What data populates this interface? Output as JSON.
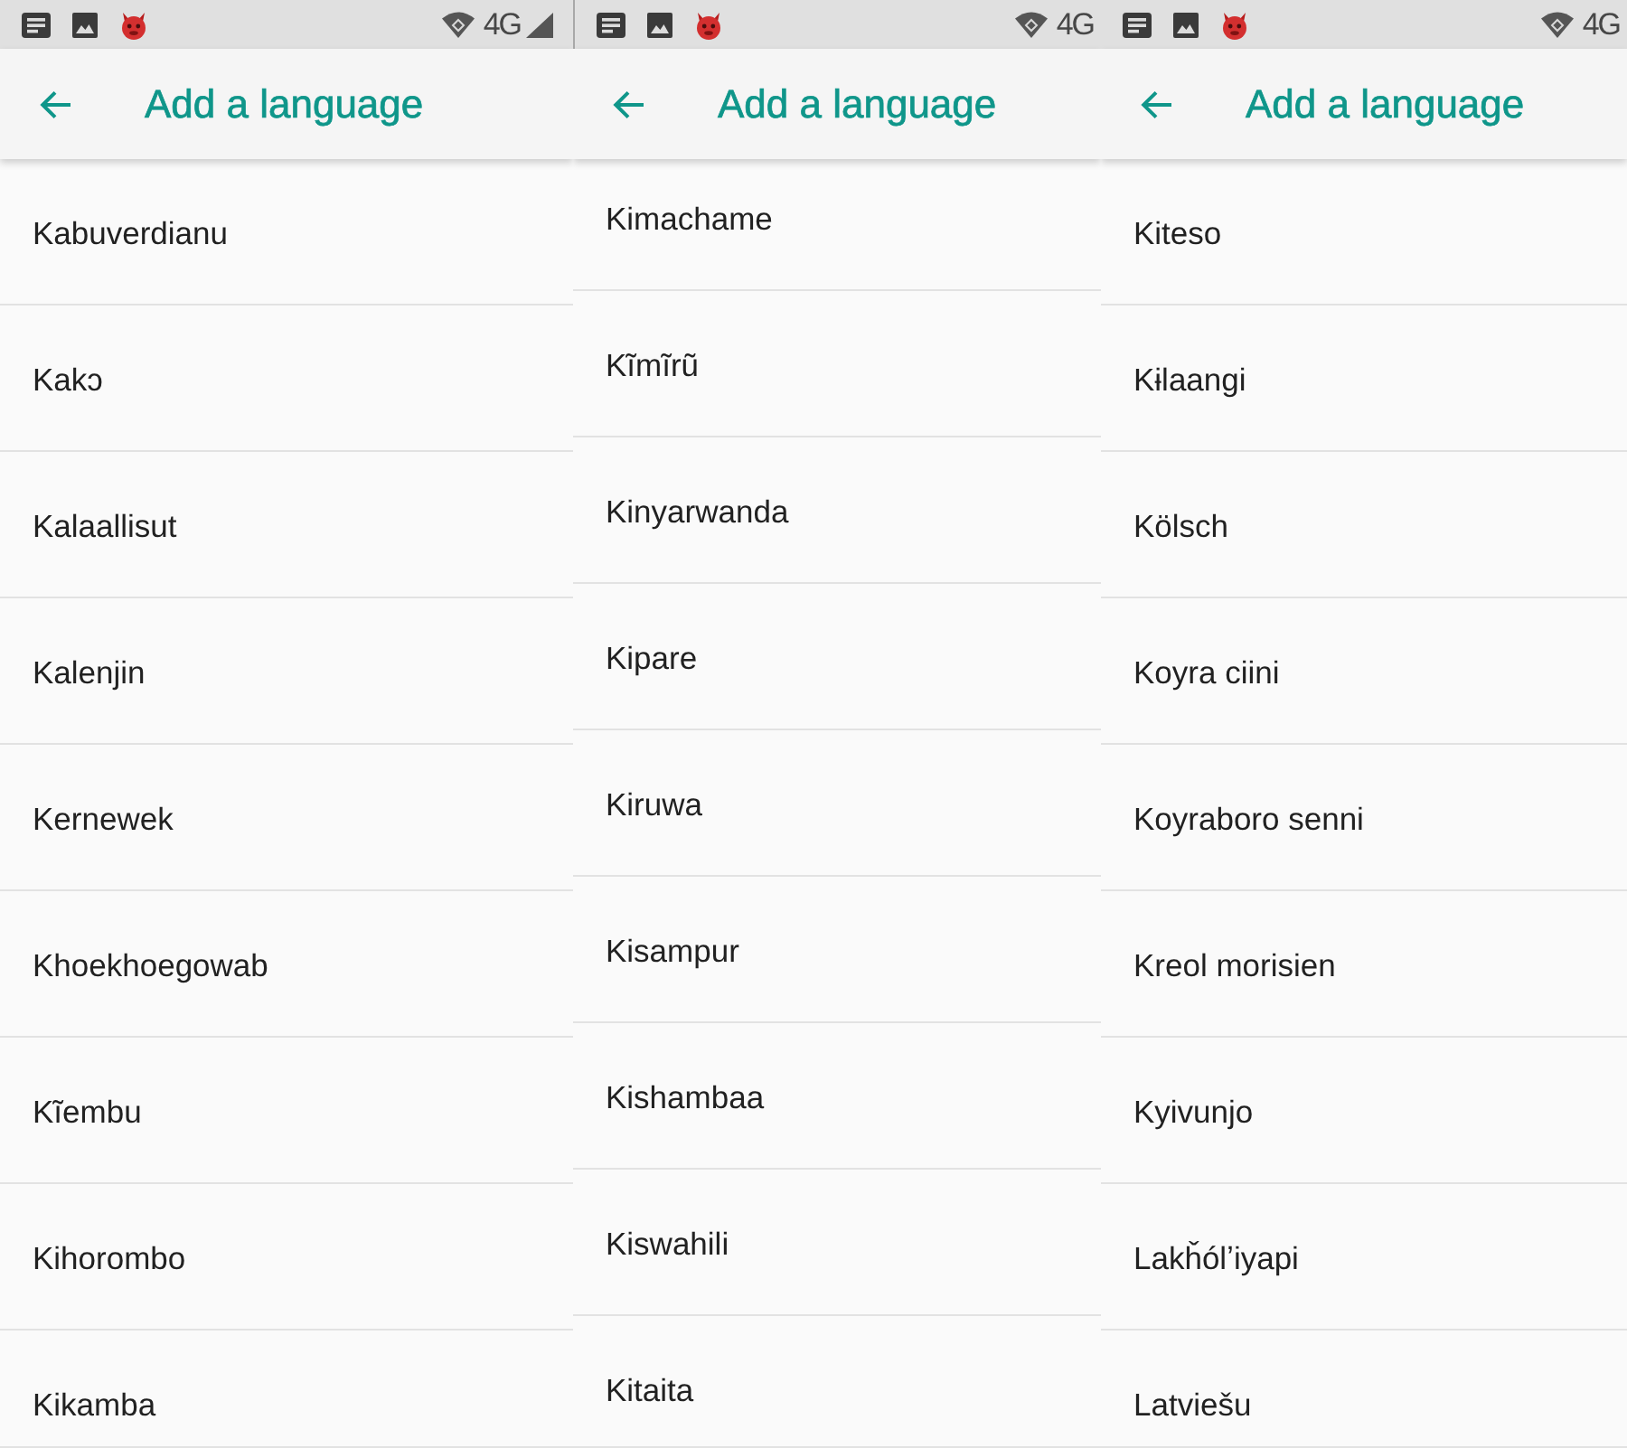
{
  "panels": [
    {
      "status_bar": {
        "network": "4G",
        "signal_icon": true
      },
      "toolbar": {
        "title": "Add a language"
      },
      "languages": [
        "Kabuverdianu",
        "Kakɔ",
        "Kalaallisut",
        "Kalenjin",
        "Kernewek",
        "Khoekhoegowab",
        "Kĩembu",
        "Kihorombo",
        "Kikamba"
      ]
    },
    {
      "status_bar": {
        "network": "4G",
        "signal_icon": false
      },
      "toolbar": {
        "title": "Add a language"
      },
      "languages": [
        "Kimachame",
        "Kĩmĩrũ",
        "Kinyarwanda",
        "Kipare",
        "Kiruwa",
        "Kisampur",
        "Kishambaa",
        "Kiswahili",
        "Kitaita"
      ]
    },
    {
      "status_bar": {
        "network": "4G",
        "signal_icon": false
      },
      "toolbar": {
        "title": "Add a language"
      },
      "languages": [
        "Kiteso",
        "Kɨlaangi",
        "Kölsch",
        "Koyra ciini",
        "Koyraboro senni",
        "Kreol morisien",
        "Kyivunjo",
        "Lakȟólʼiyapi",
        "Latviešu"
      ]
    }
  ]
}
